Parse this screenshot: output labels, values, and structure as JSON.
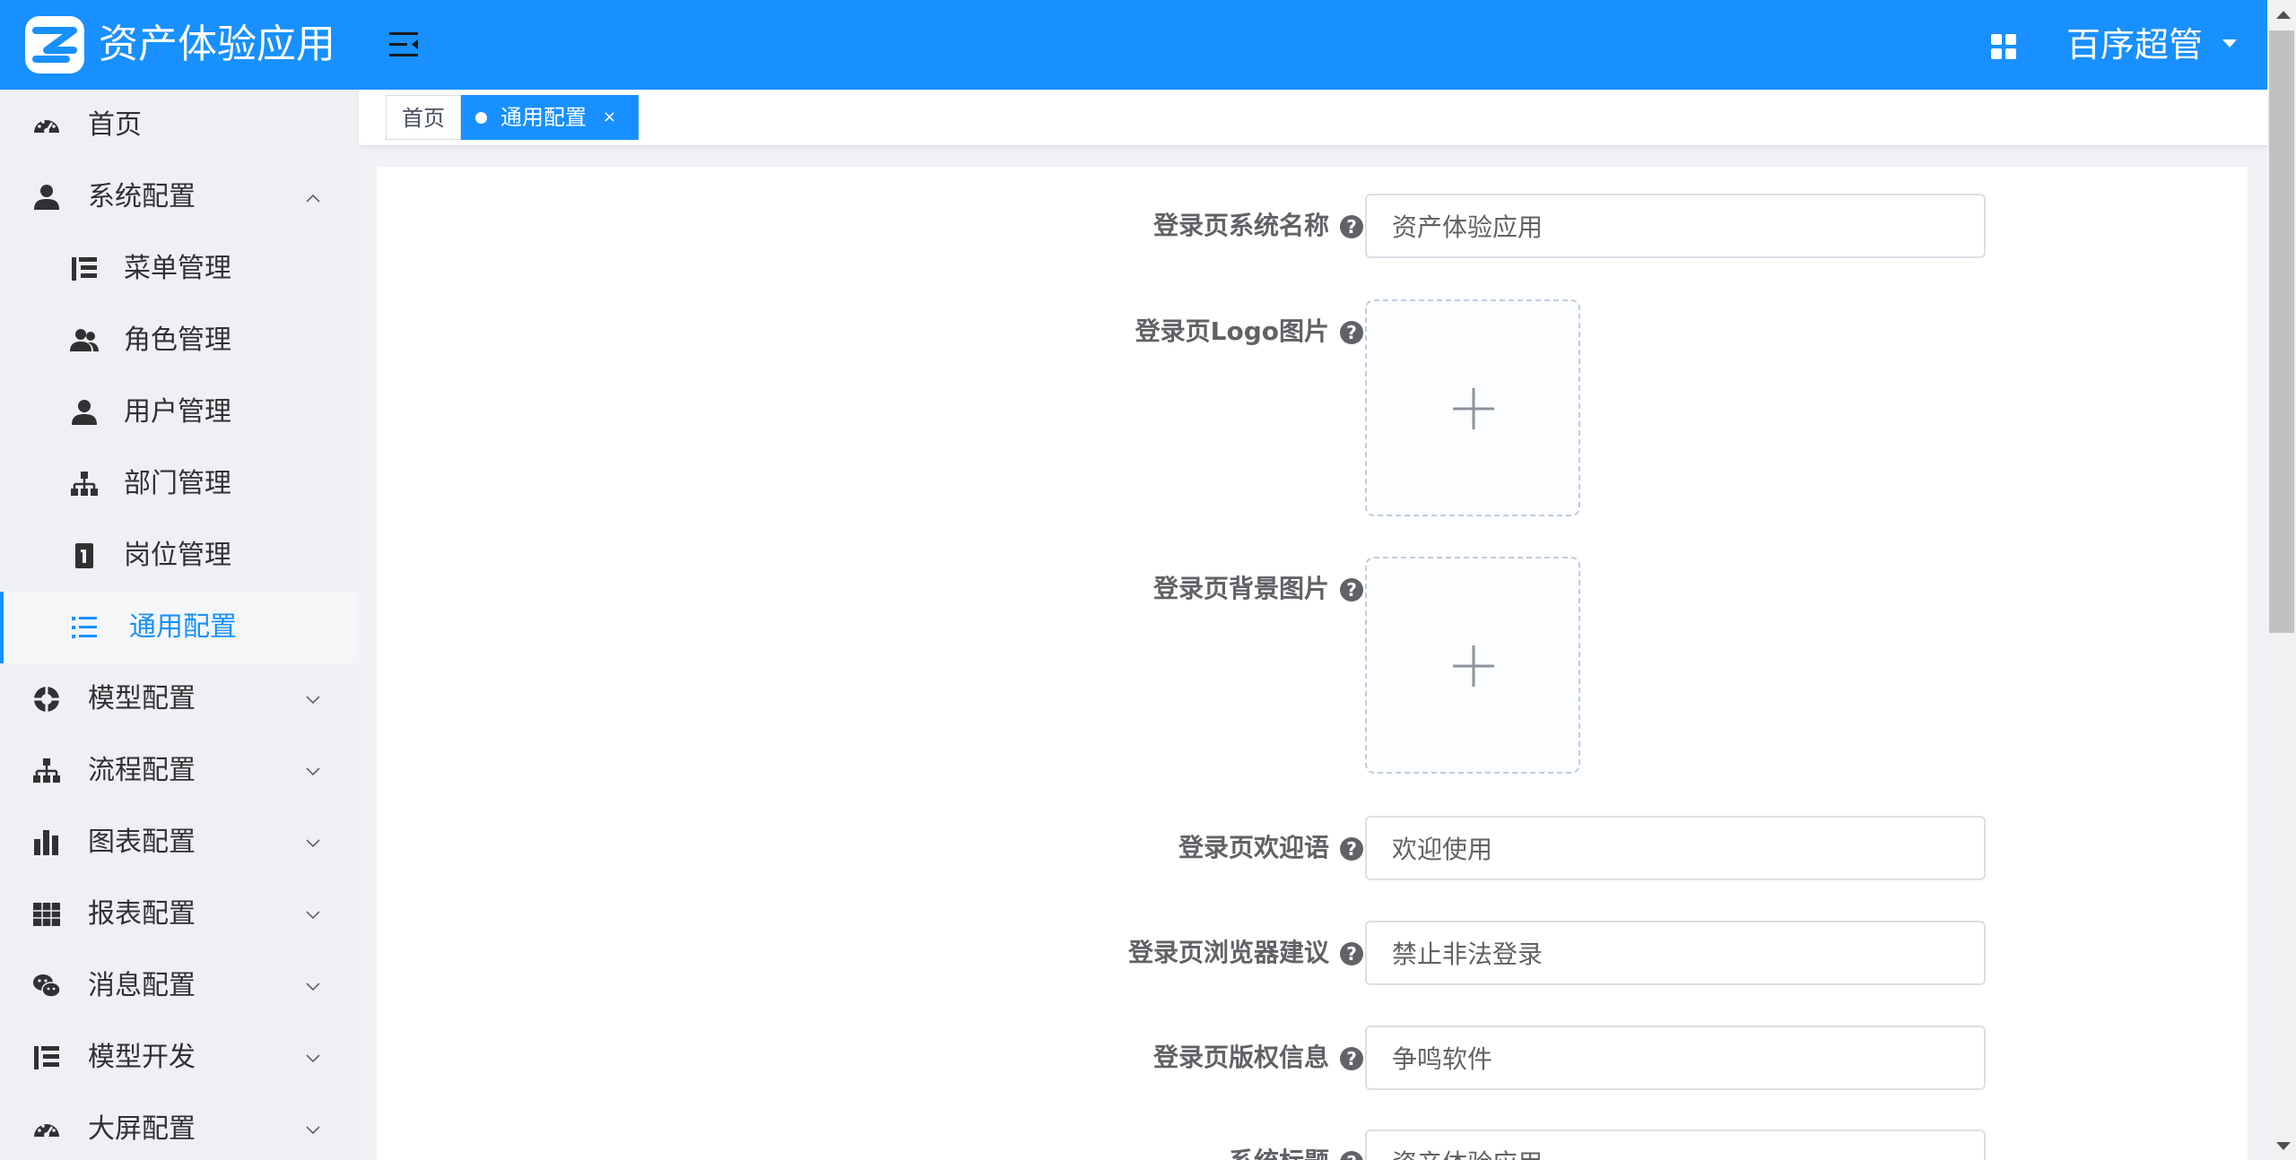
{
  "header": {
    "app_title": "资产体验应用",
    "user_name": "百序超管",
    "accent_color": "#1890ff"
  },
  "sidebar": {
    "items": [
      {
        "label": "首页",
        "icon": "dashboard-icon"
      },
      {
        "label": "系统配置",
        "icon": "user-icon",
        "expanded": true
      },
      {
        "label": "菜单管理",
        "icon": "tree-table-icon"
      },
      {
        "label": "角色管理",
        "icon": "users-icon"
      },
      {
        "label": "用户管理",
        "icon": "user-icon"
      },
      {
        "label": "部门管理",
        "icon": "sitemap-icon"
      },
      {
        "label": "岗位管理",
        "icon": "id-card-icon"
      },
      {
        "label": "通用配置",
        "icon": "list-icon",
        "active": true
      },
      {
        "label": "模型配置",
        "icon": "life-ring-icon"
      },
      {
        "label": "流程配置",
        "icon": "sitemap-icon"
      },
      {
        "label": "图表配置",
        "icon": "bar-chart-icon"
      },
      {
        "label": "报表配置",
        "icon": "table-icon"
      },
      {
        "label": "消息配置",
        "icon": "wechat-icon"
      },
      {
        "label": "模型开发",
        "icon": "tree-table-icon"
      },
      {
        "label": "大屏配置",
        "icon": "dashboard-icon"
      }
    ]
  },
  "tabs": {
    "home": "首页",
    "current": "通用配置",
    "close": "×"
  },
  "form": {
    "help_glyph": "?",
    "login_name_label": "登录页系统名称",
    "login_name_value": "资产体验应用",
    "logo_label": "登录页Logo图片",
    "bg_label": "登录页背景图片",
    "welcome_label": "登录页欢迎语",
    "welcome_value": "欢迎使用",
    "browser_label": "登录页浏览器建议",
    "browser_value": "禁止非法登录",
    "copyright_label": "登录页版权信息",
    "copyright_value": "争鸣软件",
    "sys_title_label": "系统标题",
    "sys_title_value": "资产体验应用"
  }
}
